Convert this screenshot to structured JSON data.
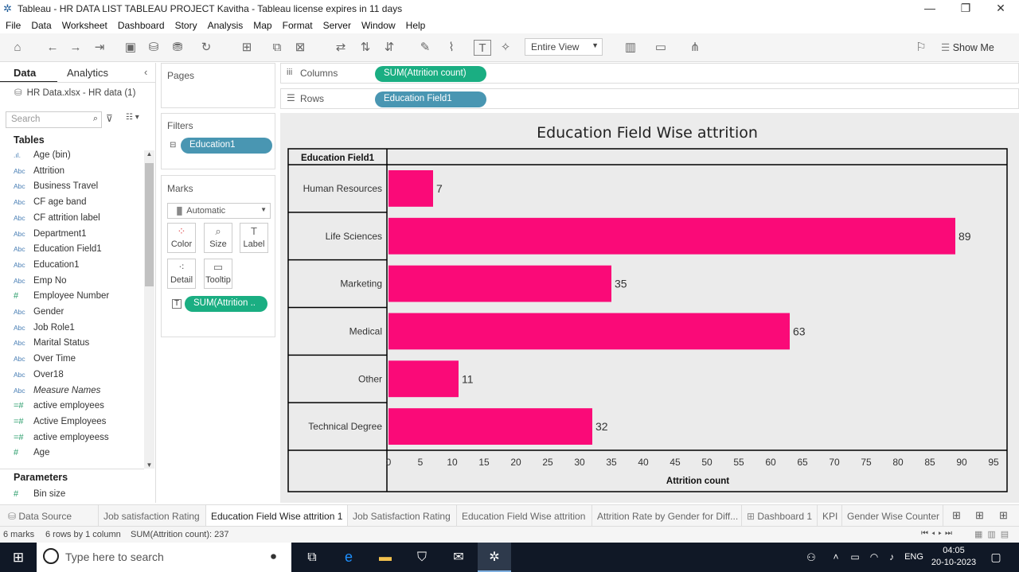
{
  "window": {
    "title": "Tableau - HR DATA LIST TABLEAU PROJECT Kavitha - Tableau license expires in 11 days"
  },
  "menu": [
    "File",
    "Data",
    "Worksheet",
    "Dashboard",
    "Story",
    "Analysis",
    "Map",
    "Format",
    "Server",
    "Window",
    "Help"
  ],
  "toolbar": {
    "fit": "Entire View",
    "show_me": "Show Me"
  },
  "left": {
    "tab_data": "Data",
    "tab_analytics": "Analytics",
    "source": "HR Data.xlsx - HR data (1)",
    "search_placeholder": "Search",
    "tables_header": "Tables",
    "fields": [
      {
        "icon": ".ıl.",
        "name": "Age (bin)"
      },
      {
        "icon": "Abc",
        "name": "Attrition"
      },
      {
        "icon": "Abc",
        "name": "Business Travel"
      },
      {
        "icon": "Abc",
        "name": "CF age band"
      },
      {
        "icon": "Abc",
        "name": "CF attrition label"
      },
      {
        "icon": "Abc",
        "name": "Department1"
      },
      {
        "icon": "Abc",
        "name": "Education Field1"
      },
      {
        "icon": "Abc",
        "name": "Education1"
      },
      {
        "icon": "Abc",
        "name": "Emp No"
      },
      {
        "icon": "#",
        "name": "Employee Number"
      },
      {
        "icon": "Abc",
        "name": "Gender"
      },
      {
        "icon": "Abc",
        "name": "Job Role1"
      },
      {
        "icon": "Abc",
        "name": "Marital Status"
      },
      {
        "icon": "Abc",
        "name": "Over Time"
      },
      {
        "icon": "Abc",
        "name": "Over18"
      },
      {
        "icon": "Abc",
        "name": "Measure Names"
      },
      {
        "icon": "=#",
        "name": "active employees"
      },
      {
        "icon": "=#",
        "name": "Active Employees"
      },
      {
        "icon": "=#",
        "name": "active employeess"
      },
      {
        "icon": "#",
        "name": "Age"
      }
    ],
    "parameters_header": "Parameters",
    "param": "Bin size"
  },
  "shelves": {
    "pages": "Pages",
    "columns": "Columns",
    "rows": "Rows",
    "columns_pill": "SUM(Attrition count)",
    "rows_pill": "Education Field1",
    "filters": "Filters",
    "filter_pill": "Education1",
    "marks": "Marks",
    "mark_type": "Automatic",
    "mark_cards": [
      "Color",
      "Size",
      "Label",
      "Detail",
      "Tooltip"
    ],
    "label_pill": "SUM(Attrition .."
  },
  "chart_data": {
    "type": "bar",
    "title": "Education Field Wise attrition",
    "row_header": "Education Field1",
    "xlabel": "Attrition count",
    "categories": [
      "Human Resources",
      "Life Sciences",
      "Marketing",
      "Medical",
      "Other",
      "Technical Degree"
    ],
    "values": [
      7,
      89,
      35,
      63,
      11,
      32
    ],
    "xlim": [
      0,
      95
    ],
    "xticks": [
      0,
      5,
      10,
      15,
      20,
      25,
      30,
      35,
      40,
      45,
      50,
      55,
      60,
      65,
      70,
      75,
      80,
      85,
      90,
      95
    ],
    "bar_color": "#fa0a78"
  },
  "sheet_tabs": [
    "Data Source",
    "Job satisfaction Rating",
    "Education Field Wise attrition 1",
    "Job Satisfaction Rating",
    "Education Field Wise attrition",
    "Attrition Rate by Gender for Diff...",
    "Dashboard 1",
    "KPI",
    "Gender Wise Counter"
  ],
  "status": {
    "marks": "6 marks",
    "rows": "6 rows by 1 column",
    "sum": "SUM(Attrition count): 237"
  },
  "taskbar": {
    "search": "Type here to search",
    "lang": "ENG",
    "time": "04:05",
    "date": "20-10-2023"
  }
}
